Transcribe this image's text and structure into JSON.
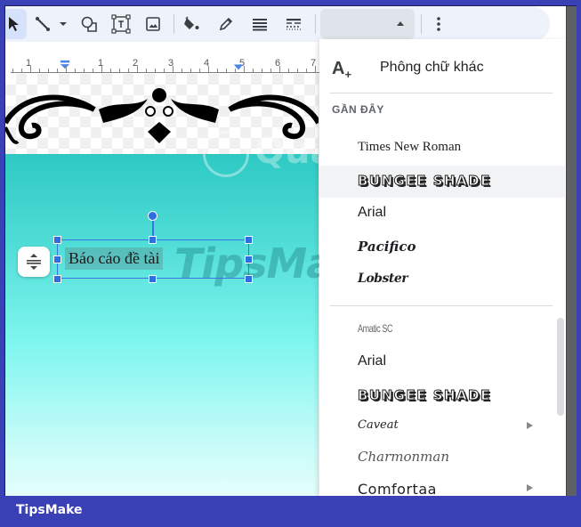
{
  "toolbar": {
    "buttons": [
      {
        "name": "select-tool",
        "icon": "cursor-arrow-icon",
        "active": true
      },
      {
        "name": "line-tool",
        "icon": "line-icon"
      },
      {
        "name": "line-dropdown",
        "icon": "caret-down-icon"
      },
      {
        "name": "shape-tool",
        "icon": "shape-icon"
      },
      {
        "name": "text-box-tool",
        "icon": "text-box-icon"
      },
      {
        "name": "image-tool",
        "icon": "image-icon"
      },
      {
        "name": "fill-color",
        "icon": "paint-bucket-icon"
      },
      {
        "name": "border-color",
        "icon": "pencil-icon"
      },
      {
        "name": "border-weight",
        "icon": "line-weight-icon"
      },
      {
        "name": "border-dash",
        "icon": "line-dash-icon"
      },
      {
        "name": "more-options",
        "icon": "more-vert-icon"
      }
    ],
    "font_select_value": ""
  },
  "ruler": {
    "labels": [
      "1",
      "1",
      "2",
      "3",
      "4",
      "5",
      "6",
      "7"
    ]
  },
  "canvas": {
    "textbox_text": "Báo cáo đề tài",
    "watermarks": [
      "TipsMake",
      "Quantrimang"
    ]
  },
  "font_menu": {
    "more_fonts_label": "Phông chữ khác",
    "more_fonts_icon": "add-font-icon",
    "recent_header": "GẦN ĐÂY",
    "recent": [
      {
        "label": "Times New Roman",
        "style": "f-times"
      },
      {
        "label": "BUNGEE SHADE",
        "style": "f-bungee",
        "hovered": true
      },
      {
        "label": "Arial",
        "style": "f-arial"
      },
      {
        "label": "Pacifico",
        "style": "f-pacifico"
      },
      {
        "label": "Lobster",
        "style": "f-lobster"
      }
    ],
    "all": [
      {
        "label": "Amatic SC",
        "style": "f-amatic"
      },
      {
        "label": "Arial",
        "style": "f-arial"
      },
      {
        "label": "BUNGEE SHADE",
        "style": "f-bungee"
      },
      {
        "label": "Caveat",
        "style": "f-caveat",
        "submenu": true
      },
      {
        "label": "Charmonman",
        "style": "f-charmon"
      },
      {
        "label": "Comfortaa",
        "style": "f-comfortaa",
        "submenu": true
      }
    ]
  },
  "footer": {
    "brand": "TipsMake"
  },
  "colors": {
    "frame_border": "#3a40b5",
    "accent": "#2d6fe0",
    "toolbar_bg": "#eef2fb"
  }
}
